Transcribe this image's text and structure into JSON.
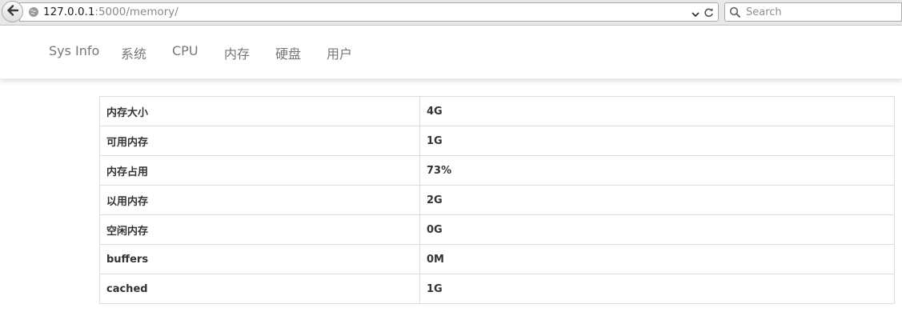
{
  "browser": {
    "url_host": "127.0.0.1",
    "url_rest": ":5000/memory/",
    "search_placeholder": "Search"
  },
  "nav": {
    "items": [
      {
        "label": "Sys Info"
      },
      {
        "label": "系统"
      },
      {
        "label": "CPU"
      },
      {
        "label": "内存"
      },
      {
        "label": "硬盘"
      },
      {
        "label": "用户"
      }
    ]
  },
  "memory_table": {
    "rows": [
      {
        "key": "内存大小",
        "value": "4G"
      },
      {
        "key": "可用内存",
        "value": "1G"
      },
      {
        "key": "内存占用",
        "value": "73%"
      },
      {
        "key": "以用内存",
        "value": "2G"
      },
      {
        "key": "空闲内存",
        "value": "0G"
      },
      {
        "key": "buffers",
        "value": "0M"
      },
      {
        "key": "cached",
        "value": "1G"
      }
    ]
  }
}
